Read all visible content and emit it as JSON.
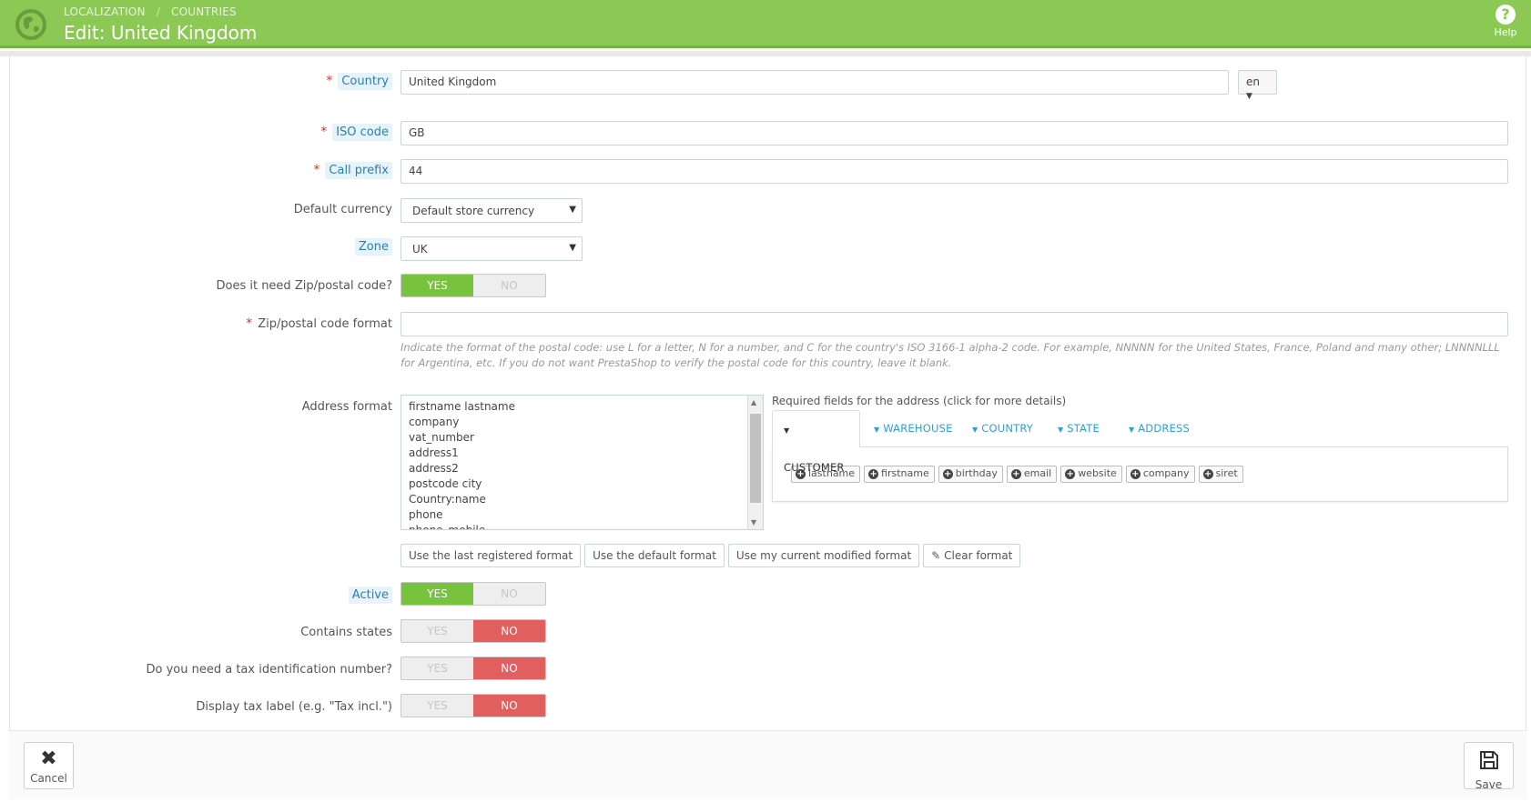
{
  "header": {
    "breadcrumb": [
      "LOCALIZATION",
      "COUNTRIES"
    ],
    "title": "Edit: United Kingdom",
    "help_label": "Help",
    "accent_color": "#8bc954"
  },
  "form": {
    "country": {
      "label": "Country",
      "value": "United Kingdom",
      "lang": "en"
    },
    "iso_code": {
      "label": "ISO code",
      "value": "GB"
    },
    "call_prefix": {
      "label": "Call prefix",
      "value": "44"
    },
    "default_currency": {
      "label": "Default currency",
      "value": "Default store currency"
    },
    "zone": {
      "label": "Zone",
      "value": "UK"
    },
    "need_zip": {
      "label": "Does it need Zip/postal code?",
      "yes": "YES",
      "no": "NO",
      "value": "YES"
    },
    "zip_format": {
      "label": "Zip/postal code format",
      "value": "",
      "help": "Indicate the format of the postal code: use L for a letter, N for a number, and C for the country's ISO 3166-1 alpha-2 code. For example, NNNNN for the United States, France, Poland and many other; LNNNNLLL for Argentina, etc. If you do not want PrestaShop to verify the postal code for this country, leave it blank."
    },
    "address_format": {
      "label": "Address format",
      "lines": [
        "firstname lastname",
        "company",
        "vat_number",
        "address1",
        "address2",
        "postcode city",
        "Country:name",
        "phone",
        "phone_mobile"
      ]
    },
    "required_fields": {
      "title": "Required fields for the address (click for more details)",
      "tabs": [
        "CUSTOMER",
        "WAREHOUSE",
        "COUNTRY",
        "STATE",
        "ADDRESS"
      ],
      "chips": [
        "lastname",
        "firstname",
        "birthday",
        "email",
        "website",
        "company",
        "siret"
      ]
    },
    "format_buttons": {
      "last_registered": "Use the last registered format",
      "default": "Use the default format",
      "current_modified": "Use my current modified format",
      "clear": "Clear format"
    },
    "active": {
      "label": "Active",
      "yes": "YES",
      "no": "NO",
      "value": "YES"
    },
    "contains_states": {
      "label": "Contains states",
      "yes": "YES",
      "no": "NO",
      "value": "NO"
    },
    "need_tax_id": {
      "label": "Do you need a tax identification number?",
      "yes": "YES",
      "no": "NO",
      "value": "NO"
    },
    "display_tax_label": {
      "label": "Display tax label (e.g. \"Tax incl.\")",
      "yes": "YES",
      "no": "NO",
      "value": "NO"
    }
  },
  "footer": {
    "cancel_label": "Cancel",
    "save_label": "Save"
  }
}
